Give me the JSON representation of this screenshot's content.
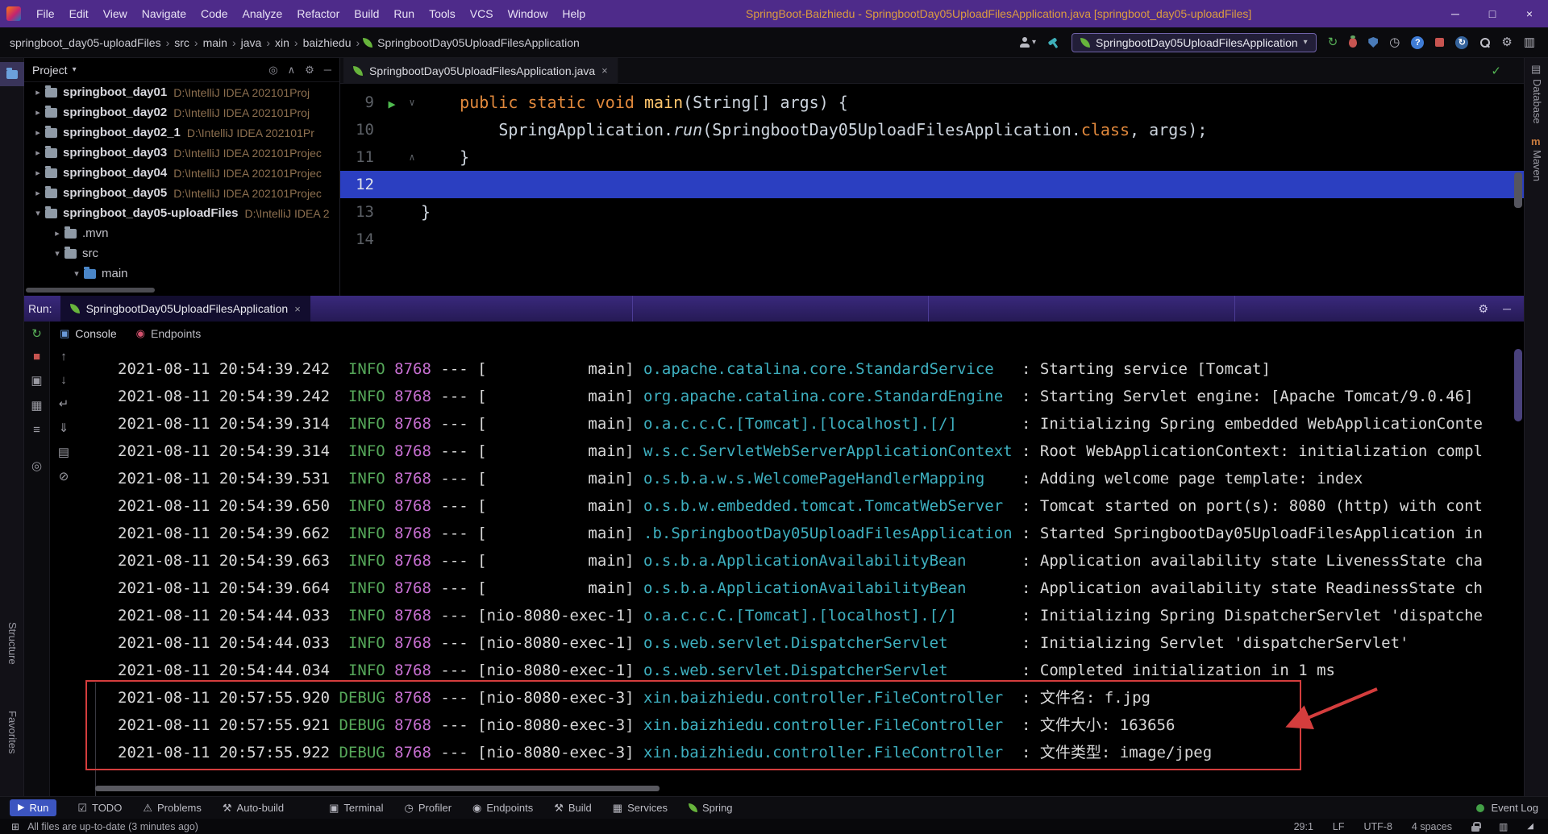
{
  "icons": {
    "dropdown": "▾",
    "chevron_right": "▸",
    "chevron_down": "▾",
    "gear": "⚙",
    "minimize": "─",
    "maximize": "□",
    "close": "×",
    "breadcrumb_sep": "›",
    "check": "✓",
    "rerun": "↻",
    "stop": "■",
    "camera": "▣",
    "layout": "▦",
    "history": "≡",
    "pin": "◎",
    "up": "↑",
    "down": "↓",
    "soft_wrap": "↵",
    "scroll_end": "⇓",
    "print": "▤",
    "clear": "⊘",
    "run": "▶",
    "todo": "☑",
    "warning": "⚠",
    "hammer": "⚒",
    "terminal": "▣",
    "profiler": "◷",
    "endpoints": "◉",
    "services": "▦",
    "console_tab": "▣",
    "help": "?",
    "locate": "◎",
    "collapse_all": "∧",
    "fold_open": "∨",
    "fold_close": "∧",
    "db": "▤",
    "maven": "m",
    "status_widget": "⊞",
    "reader": "▥",
    "grip": "◢"
  },
  "title_bar": {
    "menus": [
      "File",
      "Edit",
      "View",
      "Navigate",
      "Code",
      "Analyze",
      "Refactor",
      "Build",
      "Run",
      "Tools",
      "VCS",
      "Window",
      "Help"
    ],
    "title": "SpringBoot-Baizhiedu - SpringbootDay05UploadFilesApplication.java [springboot_day05-uploadFiles]"
  },
  "nav_bar": {
    "breadcrumbs": [
      "springboot_day05-uploadFiles",
      "src",
      "main",
      "java",
      "xin",
      "baizhiedu"
    ],
    "breadcrumb_last": "SpringbootDay05UploadFilesApplication",
    "run_config": "SpringbootDay05UploadFilesApplication"
  },
  "stripes": {
    "left": [
      "Structure",
      "Favorites"
    ],
    "right": [
      "Database",
      "Maven"
    ]
  },
  "project": {
    "header": "Project",
    "items": [
      {
        "name": "springboot_day01",
        "path": "D:\\IntelliJ IDEA 202101Proj"
      },
      {
        "name": "springboot_day02",
        "path": "D:\\IntelliJ IDEA 202101Proj"
      },
      {
        "name": "springboot_day02_1",
        "path": "D:\\IntelliJ IDEA 202101Pr"
      },
      {
        "name": "springboot_day03",
        "path": "D:\\IntelliJ IDEA 202101Projec"
      },
      {
        "name": "springboot_day04",
        "path": "D:\\IntelliJ IDEA 202101Projec"
      },
      {
        "name": "springboot_day05",
        "path": "D:\\IntelliJ IDEA 202101Projec"
      },
      {
        "name": "springboot_day05-uploadFiles",
        "path": "D:\\IntelliJ IDEA 2"
      },
      {
        "name": ".mvn",
        "path": ""
      },
      {
        "name": "src",
        "path": ""
      },
      {
        "name": "main",
        "path": ""
      }
    ]
  },
  "editor": {
    "tab": "SpringbootDay05UploadFilesApplication.java",
    "nums": [
      "9",
      "10",
      "11",
      "12",
      "13",
      "14"
    ],
    "code": {
      "l9_kw": "    public static void ",
      "l9_name": "main",
      "l9_rest": "(String[] args) {",
      "l10_pre": "        SpringApplication.",
      "l10_run": "run",
      "l10_mid": "(SpringbootDay05UploadFilesApplication.",
      "l10_class": "class",
      "l10_end": ", args);",
      "l11": "    }",
      "l13": "}"
    }
  },
  "run_panel": {
    "label": "Run:",
    "tab": "SpringbootDay05UploadFilesApplication",
    "tabs": {
      "console": "Console",
      "endpoints": "Endpoints"
    },
    "console": {
      "sep": "---",
      "colon": " : ",
      "lines": [
        {
          "t": "2021-08-11 20:54:39.242",
          "lv": "INFO",
          "pid": "8768",
          "th": "[           main]",
          "lg": "o.apache.catalina.core.StandardService",
          "msg": "Starting service [Tomcat]"
        },
        {
          "t": "2021-08-11 20:54:39.242",
          "lv": "INFO",
          "pid": "8768",
          "th": "[           main]",
          "lg": "org.apache.catalina.core.StandardEngine",
          "msg": "Starting Servlet engine: [Apache Tomcat/9.0.46]"
        },
        {
          "t": "2021-08-11 20:54:39.314",
          "lv": "INFO",
          "pid": "8768",
          "th": "[           main]",
          "lg": "o.a.c.c.C.[Tomcat].[localhost].[/]",
          "msg": "Initializing Spring embedded WebApplicationConte"
        },
        {
          "t": "2021-08-11 20:54:39.314",
          "lv": "INFO",
          "pid": "8768",
          "th": "[           main]",
          "lg": "w.s.c.ServletWebServerApplicationContext",
          "msg": "Root WebApplicationContext: initialization compl"
        },
        {
          "t": "2021-08-11 20:54:39.531",
          "lv": "INFO",
          "pid": "8768",
          "th": "[           main]",
          "lg": "o.s.b.a.w.s.WelcomePageHandlerMapping",
          "msg": "Adding welcome page template: index"
        },
        {
          "t": "2021-08-11 20:54:39.650",
          "lv": "INFO",
          "pid": "8768",
          "th": "[           main]",
          "lg": "o.s.b.w.embedded.tomcat.TomcatWebServer",
          "msg": "Tomcat started on port(s): 8080 (http) with cont"
        },
        {
          "t": "2021-08-11 20:54:39.662",
          "lv": "INFO",
          "pid": "8768",
          "th": "[           main]",
          "lg": ".b.SpringbootDay05UploadFilesApplication",
          "msg": "Started SpringbootDay05UploadFilesApplication in"
        },
        {
          "t": "2021-08-11 20:54:39.663",
          "lv": "INFO",
          "pid": "8768",
          "th": "[           main]",
          "lg": "o.s.b.a.ApplicationAvailabilityBean",
          "msg": "Application availability state LivenessState cha"
        },
        {
          "t": "2021-08-11 20:54:39.664",
          "lv": "INFO",
          "pid": "8768",
          "th": "[           main]",
          "lg": "o.s.b.a.ApplicationAvailabilityBean",
          "msg": "Application availability state ReadinessState ch"
        },
        {
          "t": "2021-08-11 20:54:44.033",
          "lv": "INFO",
          "pid": "8768",
          "th": "[nio-8080-exec-1]",
          "lg": "o.a.c.c.C.[Tomcat].[localhost].[/]",
          "msg": "Initializing Spring DispatcherServlet 'dispatche"
        },
        {
          "t": "2021-08-11 20:54:44.033",
          "lv": "INFO",
          "pid": "8768",
          "th": "[nio-8080-exec-1]",
          "lg": "o.s.web.servlet.DispatcherServlet",
          "msg": "Initializing Servlet 'dispatcherServlet'"
        },
        {
          "t": "2021-08-11 20:54:44.034",
          "lv": "INFO",
          "pid": "8768",
          "th": "[nio-8080-exec-1]",
          "lg": "o.s.web.servlet.DispatcherServlet",
          "msg": "Completed initialization in 1 ms"
        },
        {
          "t": "2021-08-11 20:57:55.920",
          "lv": "DEBUG",
          "pid": "8768",
          "th": "[nio-8080-exec-3]",
          "lg": "xin.baizhiedu.controller.FileController",
          "msg": "文件名: f.jpg"
        },
        {
          "t": "2021-08-11 20:57:55.921",
          "lv": "DEBUG",
          "pid": "8768",
          "th": "[nio-8080-exec-3]",
          "lg": "xin.baizhiedu.controller.FileController",
          "msg": "文件大小: 163656"
        },
        {
          "t": "2021-08-11 20:57:55.922",
          "lv": "DEBUG",
          "pid": "8768",
          "th": "[nio-8080-exec-3]",
          "lg": "xin.baizhiedu.controller.FileController",
          "msg": "文件类型: image/jpeg"
        }
      ]
    }
  },
  "bottom_bar": {
    "run": "Run",
    "todo": "TODO",
    "problems": "Problems",
    "autobuild": "Auto-build",
    "terminal": "Terminal",
    "profiler": "Profiler",
    "endpoints": "Endpoints",
    "build": "Build",
    "services": "Services",
    "spring": "Spring",
    "event_log": "Event Log"
  },
  "status_bar": {
    "left": "All files are up-to-date (3 minutes ago)",
    "position": "29:1",
    "line_sep": "LF",
    "encoding": "UTF-8",
    "indent": "4 spaces"
  }
}
